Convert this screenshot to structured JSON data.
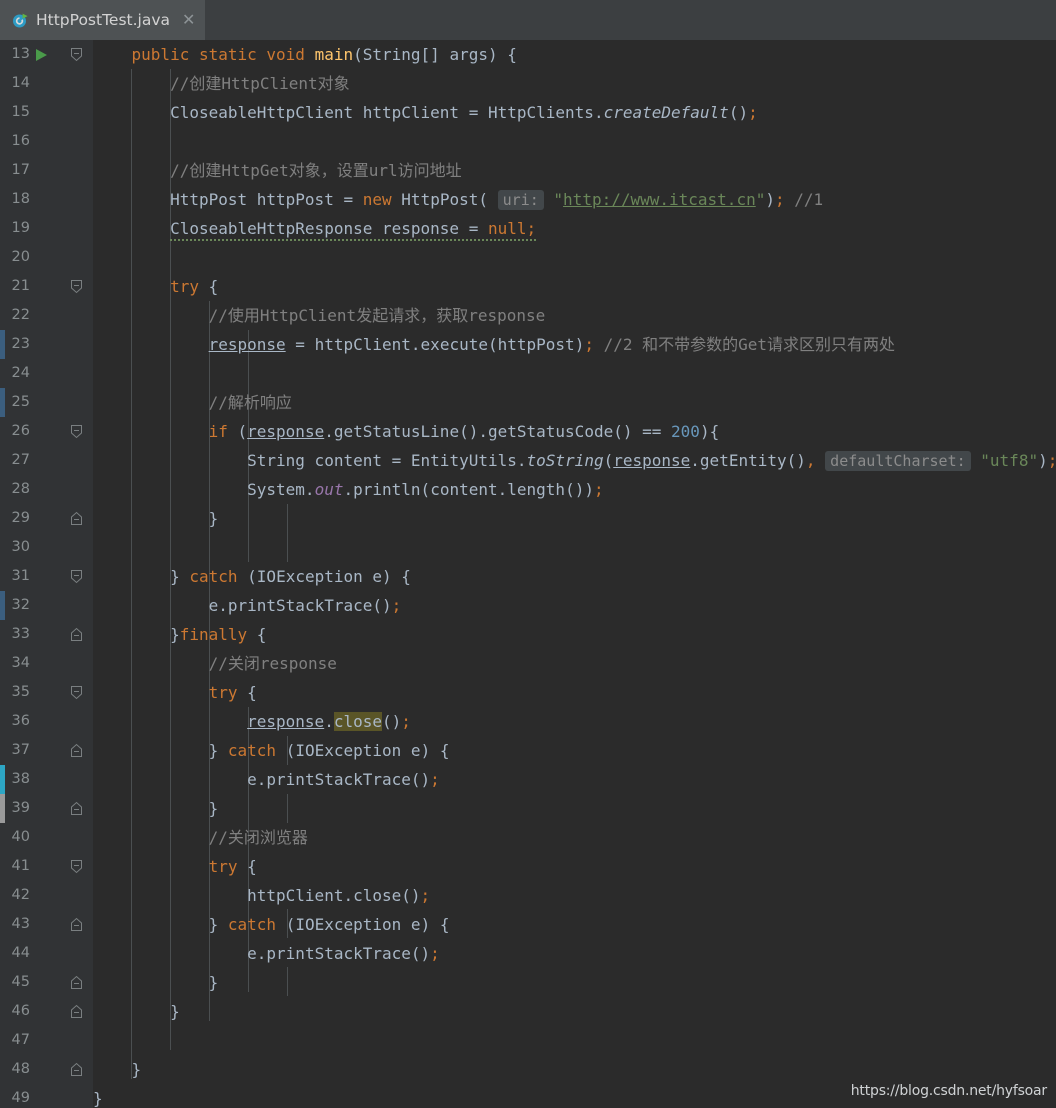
{
  "tab": {
    "label": "HttpPostTest.java",
    "icon": "java-runnable-class-icon",
    "close_icon": "close-icon",
    "accent_color": "#3592c4",
    "run_color": "#4a9b4a"
  },
  "editor": {
    "background": "#2b2b2b",
    "gutter_background": "#313335",
    "first_line": 13,
    "last_line": 49,
    "lines": [
      {
        "n": 13,
        "run": true,
        "fold": "start",
        "change": "",
        "indent": 0
      },
      {
        "n": 14,
        "run": false,
        "fold": "",
        "change": "",
        "indent": 0
      },
      {
        "n": 15,
        "run": false,
        "fold": "",
        "change": "",
        "indent": 0
      },
      {
        "n": 16,
        "run": false,
        "fold": "",
        "change": "",
        "indent": 0
      },
      {
        "n": 17,
        "run": false,
        "fold": "",
        "change": "",
        "indent": 0
      },
      {
        "n": 18,
        "run": false,
        "fold": "",
        "change": "",
        "indent": 0
      },
      {
        "n": 19,
        "run": false,
        "fold": "",
        "change": "",
        "indent": 0
      },
      {
        "n": 20,
        "run": false,
        "fold": "",
        "change": "",
        "indent": 0
      },
      {
        "n": 21,
        "run": false,
        "fold": "start",
        "change": "",
        "indent": 0
      },
      {
        "n": 22,
        "run": false,
        "fold": "",
        "change": "",
        "indent": 0
      },
      {
        "n": 23,
        "run": false,
        "fold": "",
        "change": "blue",
        "indent": 0
      },
      {
        "n": 24,
        "run": false,
        "fold": "",
        "change": "",
        "indent": 0
      },
      {
        "n": 25,
        "run": false,
        "fold": "",
        "change": "blue",
        "indent": 0
      },
      {
        "n": 26,
        "run": false,
        "fold": "start",
        "change": "",
        "indent": 0
      },
      {
        "n": 27,
        "run": false,
        "fold": "",
        "change": "",
        "indent": 0
      },
      {
        "n": 28,
        "run": false,
        "fold": "",
        "change": "",
        "indent": 0
      },
      {
        "n": 29,
        "run": false,
        "fold": "end",
        "change": "",
        "indent": 0
      },
      {
        "n": 30,
        "run": false,
        "fold": "",
        "change": "",
        "indent": 0
      },
      {
        "n": 31,
        "run": false,
        "fold": "start",
        "change": "",
        "indent": 0
      },
      {
        "n": 32,
        "run": false,
        "fold": "",
        "change": "blue",
        "indent": 0
      },
      {
        "n": 33,
        "run": false,
        "fold": "end",
        "change": "",
        "indent": 0
      },
      {
        "n": 34,
        "run": false,
        "fold": "",
        "change": "",
        "indent": 0
      },
      {
        "n": 35,
        "run": false,
        "fold": "start",
        "change": "",
        "indent": 0
      },
      {
        "n": 36,
        "run": false,
        "fold": "",
        "change": "",
        "indent": 0
      },
      {
        "n": 37,
        "run": false,
        "fold": "end",
        "change": "",
        "indent": 0
      },
      {
        "n": 38,
        "run": false,
        "fold": "",
        "change": "cyan",
        "indent": 0
      },
      {
        "n": 39,
        "run": false,
        "fold": "end",
        "change": "gray",
        "indent": 0
      },
      {
        "n": 40,
        "run": false,
        "fold": "",
        "change": "",
        "indent": 0
      },
      {
        "n": 41,
        "run": false,
        "fold": "start",
        "change": "",
        "indent": 0
      },
      {
        "n": 42,
        "run": false,
        "fold": "",
        "change": "",
        "indent": 0
      },
      {
        "n": 43,
        "run": false,
        "fold": "end",
        "change": "",
        "indent": 0
      },
      {
        "n": 44,
        "run": false,
        "fold": "",
        "change": "",
        "indent": 0
      },
      {
        "n": 45,
        "run": false,
        "fold": "end",
        "change": "",
        "indent": 0
      },
      {
        "n": 46,
        "run": false,
        "fold": "end",
        "change": "",
        "indent": 0
      },
      {
        "n": 47,
        "run": false,
        "fold": "",
        "change": "",
        "indent": 0
      },
      {
        "n": 48,
        "run": false,
        "fold": "end",
        "change": "",
        "indent": 0
      },
      {
        "n": 49,
        "run": false,
        "fold": "",
        "change": "",
        "indent": 0
      }
    ],
    "source_text": [
      "    public static void main(String[] args) {",
      "        //创建HttpClient对象",
      "        CloseableHttpClient httpClient = HttpClients.createDefault();",
      "",
      "        //创建HttpGet对象，设置url访问地址",
      "        HttpPost httpPost = new HttpPost( uri: \"http://www.itcast.cn\"); //1",
      "        CloseableHttpResponse response = null;",
      "",
      "        try {",
      "            //使用HttpClient发起请求，获取response",
      "            response = httpClient.execute(httpPost); //2 和不带参数的Get请求区别只有两处",
      "",
      "            //解析响应",
      "            if (response.getStatusLine().getStatusCode() == 200){",
      "                String content = EntityUtils.toString(response.getEntity(), defaultCharset: \"utf8\");",
      "                System.out.println(content.length());",
      "            }",
      "",
      "        } catch (IOException e) {",
      "            e.printStackTrace();",
      "        }finally {",
      "            //关闭response",
      "            try {",
      "                response.close();",
      "            } catch (IOException e) {",
      "                e.printStackTrace();",
      "            }",
      "            //关闭浏览器",
      "            try {",
      "                httpClient.close();",
      "            } catch (IOException e) {",
      "                e.printStackTrace();",
      "            }",
      "        }",
      "",
      "    }",
      "}"
    ],
    "inline_hints": [
      {
        "line": 18,
        "label": "uri:"
      },
      {
        "line": 27,
        "label": "defaultCharset:"
      }
    ],
    "highlighted_identifier": "close",
    "string_literals": [
      "\"http://www.itcast.cn\"",
      "\"utf8\""
    ],
    "comments": [
      "//创建HttpClient对象",
      "//创建HttpGet对象，设置url访问地址",
      "//1",
      "//使用HttpClient发起请求，获取response",
      "//2 和不带参数的Get请求区别只有两处",
      "//解析响应",
      "//关闭response",
      "//关闭浏览器"
    ],
    "syntax_colors": {
      "keyword": "#cc7832",
      "identifier": "#a9b7c6",
      "method_declaration": "#ffc66d",
      "number": "#6897bb",
      "string": "#6a8759",
      "comment": "#808080",
      "static_field": "#9876aa",
      "hint_background": "#42474a",
      "caret_highlight": "#5a5527"
    }
  },
  "watermark": {
    "text": "https://blog.csdn.net/hyfsoar"
  }
}
